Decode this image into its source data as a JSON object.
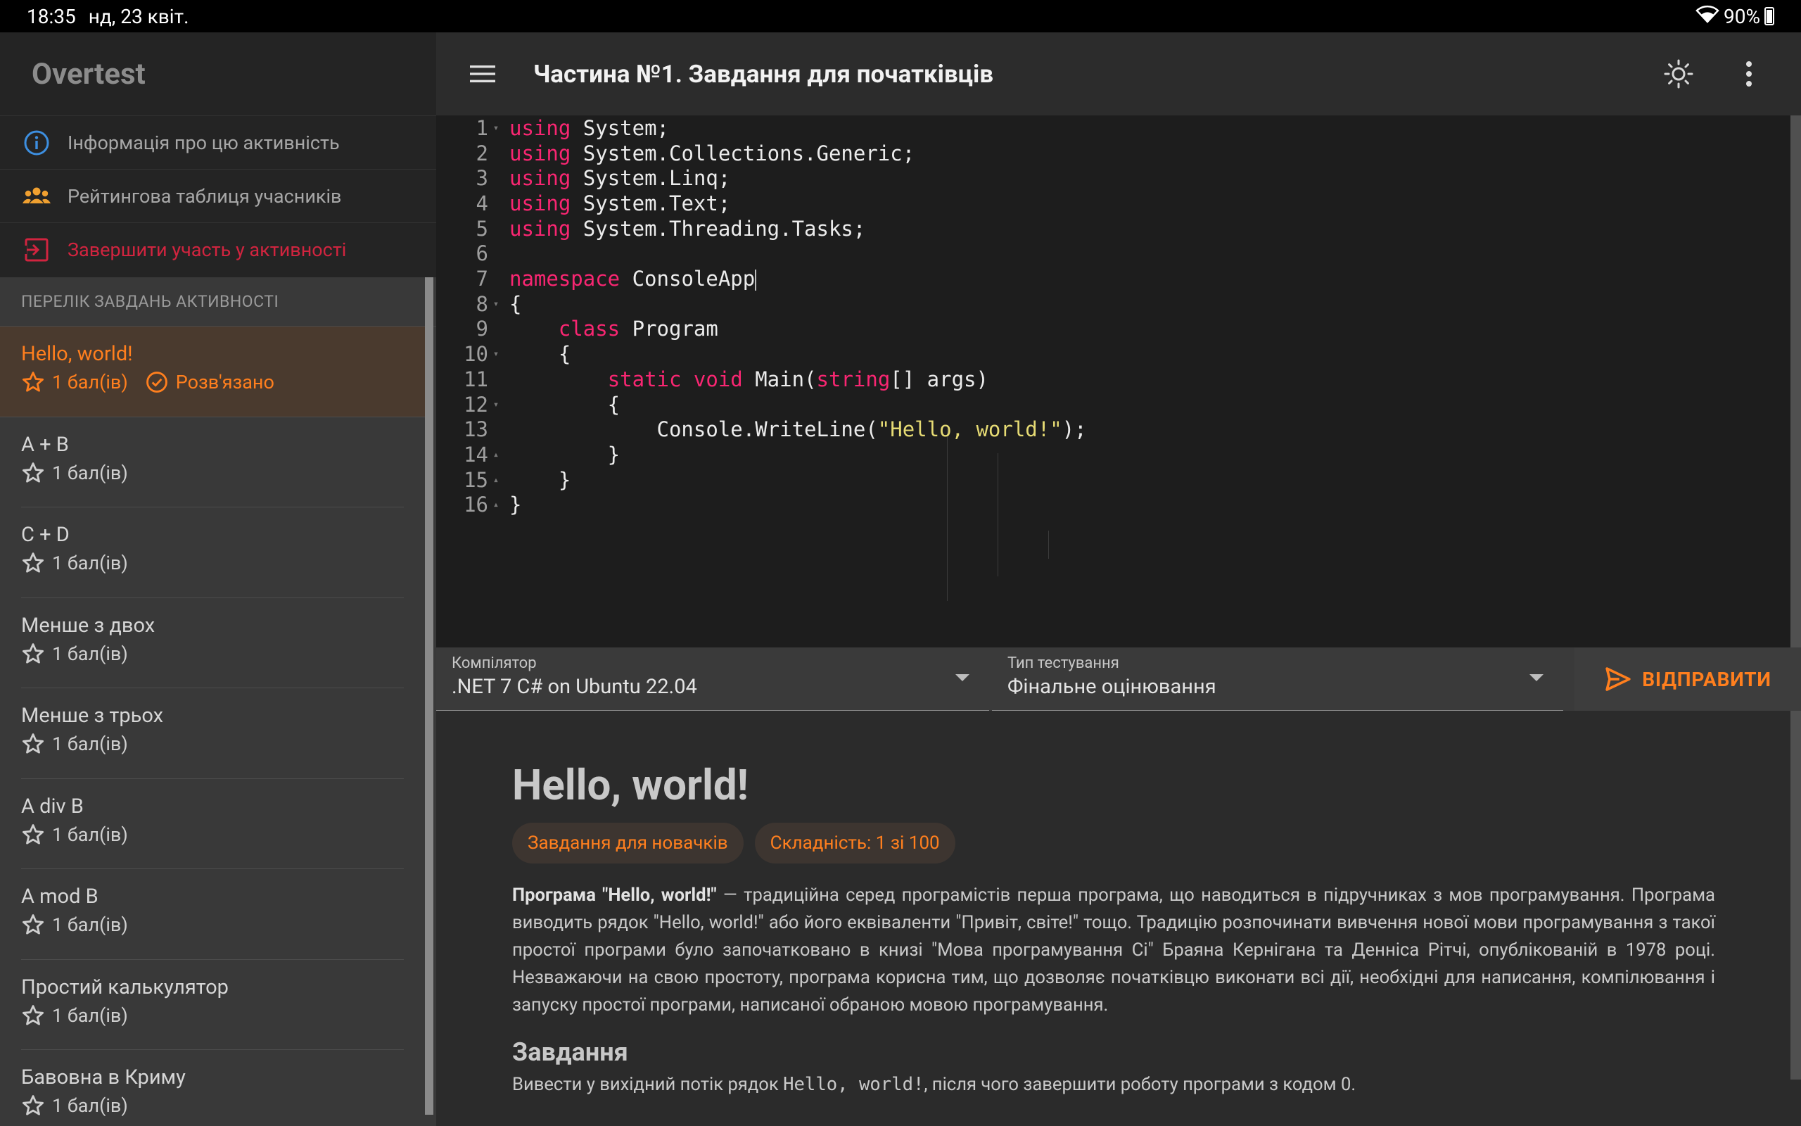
{
  "status_bar": {
    "time": "18:35",
    "date": "нд, 23 квіт.",
    "battery": "90%"
  },
  "sidebar": {
    "app_title": "Overtest",
    "links": [
      {
        "label": "Інформація про цю активність",
        "icon": "info-icon"
      },
      {
        "label": "Рейтингова таблиця учасників",
        "icon": "groups-icon"
      },
      {
        "label": "Завершити участь у активності",
        "icon": "exit-icon"
      }
    ],
    "tasks_header": "Перелік завдань активності",
    "tasks": [
      {
        "name": "Hello, world!",
        "points": "1 бал(ів)",
        "solved": "Розв'язано"
      },
      {
        "name": "A + B",
        "points": "1 бал(ів)"
      },
      {
        "name": "C + D",
        "points": "1 бал(ів)"
      },
      {
        "name": "Менше з двох",
        "points": "1 бал(ів)"
      },
      {
        "name": "Менше з трьох",
        "points": "1 бал(ів)"
      },
      {
        "name": "A div B",
        "points": "1 бал(ів)"
      },
      {
        "name": "A mod B",
        "points": "1 бал(ів)"
      },
      {
        "name": "Простий калькулятор",
        "points": "1 бал(ів)"
      },
      {
        "name": "Бавовна в Криму",
        "points": "1 бал(ів)"
      }
    ]
  },
  "appbar": {
    "title": "Частина №1. Завдання для початківців"
  },
  "editor": {
    "line_numbers": [
      "1",
      "2",
      "3",
      "4",
      "5",
      "6",
      "7",
      "8",
      "9",
      "10",
      "11",
      "12",
      "13",
      "14",
      "15",
      "16"
    ],
    "lines": [
      {
        "kw": "using",
        "rest": " System;"
      },
      {
        "kw": "using",
        "rest": " System.Collections.Generic;"
      },
      {
        "kw": "using",
        "rest": " System.Linq;"
      },
      {
        "kw": "using",
        "rest": " System.Text;"
      },
      {
        "kw": "using",
        "rest": " System.Threading.Tasks;"
      },
      {
        "text": ""
      },
      {
        "kw": "namespace",
        "rest": " ConsoleApp"
      },
      {
        "text": "{"
      },
      {
        "indent": "    ",
        "kw": "class",
        "rest": " Program"
      },
      {
        "text": "    {"
      },
      {
        "indent": "        ",
        "kw": "static",
        "mid": " ",
        "kw2": "void",
        "mid2": " Main(",
        "kw3": "string",
        "rest": "[] args)"
      },
      {
        "text": "        {"
      },
      {
        "pre": "            Console.WriteLine(",
        "str": "\"Hello, world!\"",
        "rest": ");"
      },
      {
        "text": "        }"
      },
      {
        "text": "    }"
      },
      {
        "text": "}"
      }
    ]
  },
  "compiler": {
    "label": "Компілятор",
    "value": ".NET 7 C# on Ubuntu 22.04"
  },
  "testing": {
    "label": "Тип тестування",
    "value": "Фінальне оцінювання"
  },
  "send_button": "ВІДПРАВИТИ",
  "problem": {
    "title": "Hello, world!",
    "chips": [
      "Завдання для новачків",
      "Складність: 1 зі 100"
    ],
    "desc_bold": "Програма \"Hello, world!\"",
    "desc_rest": " — традиційна серед програмістів перша програма, що наводиться в підручниках з мов програмування. Програма виводить рядок \"Hello, world!\" або його еквіваленти \"Привіт, світе!\" тощо. Традицію розпочинати вивчення нової мови програмування з такої простої програми було започатковано в книзі \"Мова програмування Сі\" Браяна Кернігана та Денніса Рітчі, опублікованій в 1978 році. Незважаючи на свою простоту, програма корисна тим, що дозволяє початківцю виконати всі дії, необхідні для написання, компілювання і запуску простої програми, написаної обраною мовою програмування.",
    "task_heading": "Завдання",
    "task_pre": "Вивести у вихідний потік рядок ",
    "task_code": "Hello, world!",
    "task_post": ", після чого завершити роботу програми з кодом 0."
  },
  "colors": {
    "accent": "#ff7f1e",
    "danger": "#d1243f",
    "keyword": "#f92672",
    "string": "#e6db74",
    "info": "#3d8fe0"
  }
}
